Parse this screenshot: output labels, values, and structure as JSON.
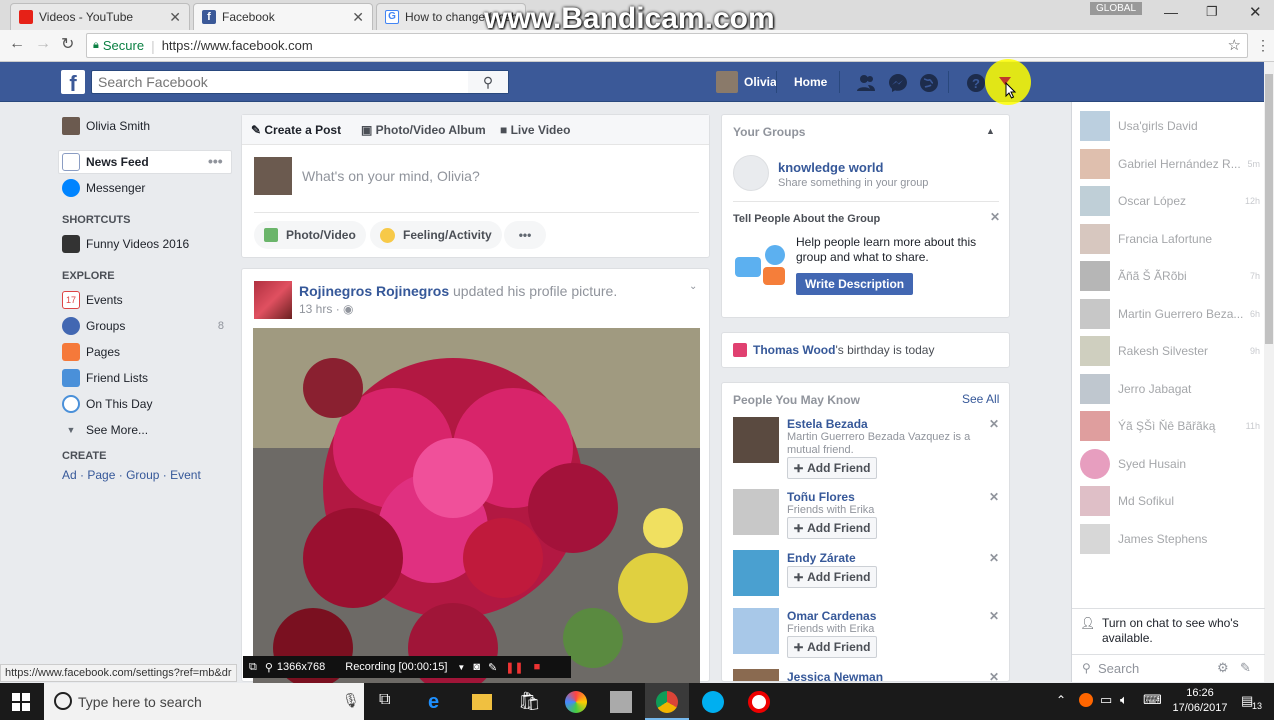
{
  "browser": {
    "tabs": [
      {
        "title": "Videos - YouTube",
        "favicon_color": "#e62117"
      },
      {
        "title": "Facebook",
        "favicon_color": "#3b5998"
      },
      {
        "title": "How to change faceb",
        "favicon_color": "#4285f4"
      }
    ],
    "window_label": "GLOBAL",
    "secure_label": "Secure",
    "url": "https://www.facebook.com",
    "watermark": "www.Bandicam.com"
  },
  "fb_header": {
    "search_placeholder": "Search Facebook",
    "user_name": "Olivia",
    "home_label": "Home"
  },
  "left_nav": {
    "profile_name": "Olivia Smith",
    "news_feed": "News Feed",
    "messenger": "Messenger",
    "shortcuts_heading": "SHORTCUTS",
    "shortcut_item": "Funny Videos 2016",
    "explore_heading": "EXPLORE",
    "explore": [
      {
        "label": "Events",
        "count": ""
      },
      {
        "label": "Groups",
        "count": "8"
      },
      {
        "label": "Pages",
        "count": ""
      },
      {
        "label": "Friend Lists",
        "count": ""
      },
      {
        "label": "On This Day",
        "count": ""
      }
    ],
    "see_more": "See More...",
    "create_heading": "CREATE",
    "create_links": [
      "Ad",
      "Page",
      "Group",
      "Event"
    ]
  },
  "composer": {
    "tabs": [
      "Create a Post",
      "Photo/Video Album",
      "Live Video"
    ],
    "placeholder": "What's on your mind, Olivia?",
    "actions": [
      "Photo/Video",
      "Feeling/Activity"
    ]
  },
  "post": {
    "author": "Rojinegros Rojinegros",
    "action": "updated his profile picture.",
    "time": "13 hrs"
  },
  "groups_card": {
    "title": "Your Groups",
    "group_name": "knowledge world",
    "group_sub": "Share something in your group",
    "tell_heading": "Tell People About the Group",
    "tell_body": "Help people learn more about this group and what to share.",
    "write_button": "Write Description"
  },
  "birthday": {
    "name": "Thomas Wood",
    "text": "'s birthday is today"
  },
  "pymk": {
    "title": "People You May Know",
    "see_all": "See All",
    "add_label": "Add Friend",
    "people": [
      {
        "name": "Estela Bezada",
        "sub": "Martin Guerrero Bezada Vazquez is a mutual friend."
      },
      {
        "name": "Toñu Flores",
        "sub": "Friends with Erika"
      },
      {
        "name": "Endy Zárate",
        "sub": ""
      },
      {
        "name": "Omar Cardenas",
        "sub": "Friends with Erika"
      },
      {
        "name": "Jessica Newman",
        "sub": ""
      }
    ]
  },
  "chat": {
    "contacts": [
      {
        "name": "Usa'girls David",
        "time": ""
      },
      {
        "name": "Gabriel Hernández R...",
        "time": "5m"
      },
      {
        "name": "Oscar López",
        "time": "12h"
      },
      {
        "name": "Francia Lafortune",
        "time": ""
      },
      {
        "name": "Ãñã Š ÃRõbi",
        "time": "7h"
      },
      {
        "name": "Martin Guerrero Beza...",
        "time": "6h"
      },
      {
        "name": "Rakesh Silvester",
        "time": "9h"
      },
      {
        "name": "Jerro Jabagat",
        "time": ""
      },
      {
        "name": "Ýã ŞŠì Ňê Bãřãką",
        "time": "11h"
      },
      {
        "name": "Syed Husain",
        "time": ""
      },
      {
        "name": "Md Sofikul",
        "time": ""
      },
      {
        "name": "James Stephens",
        "time": ""
      }
    ],
    "turn_on": "Turn on chat to see who's available.",
    "search": "Search"
  },
  "status_url": "https://www.facebook.com/settings?ref=mb&dr",
  "recorder": {
    "resolution": "1366x768",
    "recording": "Recording [00:00:15]"
  },
  "taskbar": {
    "search_placeholder": "Type here to search",
    "time": "16:26",
    "date": "17/06/2017",
    "notifications": "13"
  }
}
